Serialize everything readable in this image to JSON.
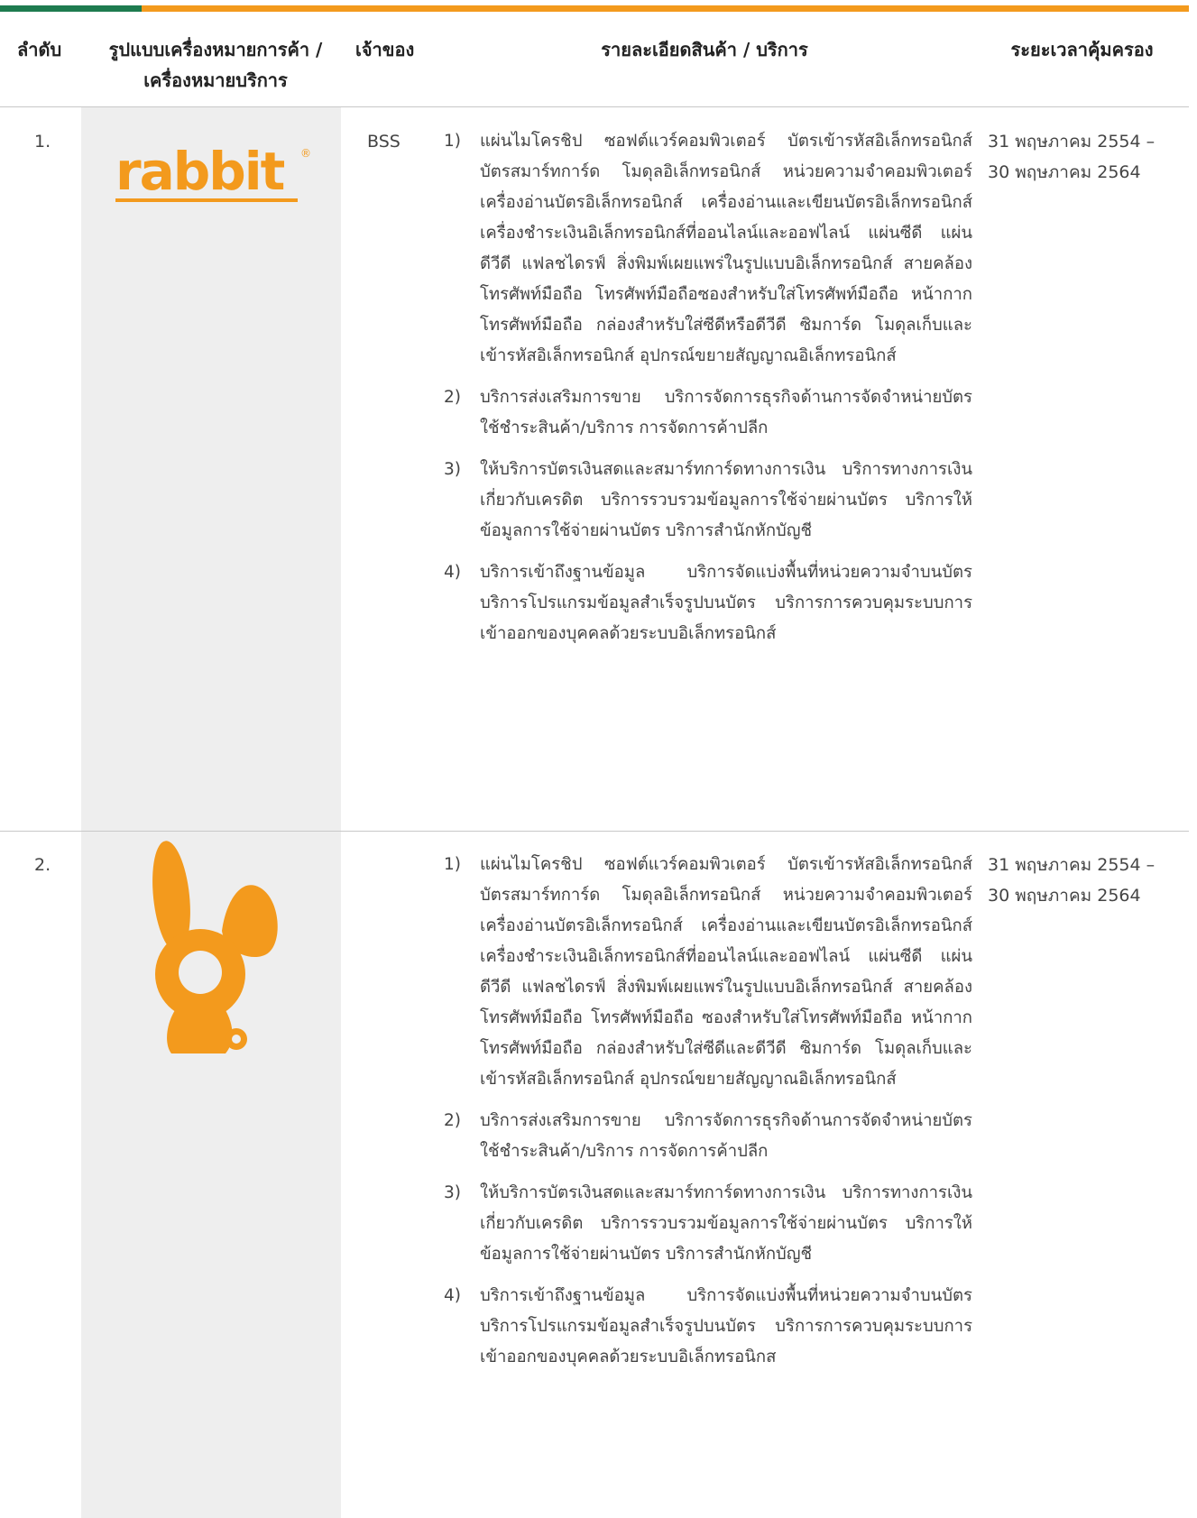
{
  "header": {
    "order": "ลำดับ",
    "logo_line1": "รูปแบบเครื่องหมายการค้า /",
    "logo_line2": "เครื่องหมายบริการ",
    "owner": "เจ้าของ",
    "detail": "รายละเอียดสินค้า / บริการ",
    "period": "ระยะเวลาคุ้มครอง"
  },
  "colors": {
    "brand_orange": "#f39a1d",
    "brand_green": "#1e7b4f",
    "shade": "#eeeeee"
  },
  "rows": [
    {
      "order": "1.",
      "logo_icon": "rabbit-wordmark-logo",
      "logo_text": "rabbit",
      "registered_mark": "®",
      "owner": "BSS",
      "period_line1": "31 พฤษภาคม 2554 –",
      "period_line2": "30 พฤษภาคม 2564",
      "items": [
        {
          "num": "1)",
          "text": "แผ่นไมโครชิป ซอฟต์แวร์คอมพิวเตอร์ บัตรเข้ารหัสอิเล็กทรอนิกส์ บัตรสมาร์ทการ์ด โมดุลอิเล็กทรอนิกส์ หน่วยความจำคอมพิวเตอร์ เครื่องอ่านบัตรอิเล็กทรอนิกส์ เครื่องอ่านและเขียนบัตรอิเล็กทรอนิกส์ เครื่องชำระเงินอิเล็กทรอนิกส์ที่ออนไลน์และออฟไลน์ แผ่นซีดี แผ่นดีวีดี แฟลชไดรฟ์ สิ่งพิมพ์เผยแพร่ในรูปแบบอิเล็กทรอนิกส์ สายคล้องโทรศัพท์มือถือ โทรศัพท์มือถือซองสำหรับใส่โทรศัพท์มือถือ หน้ากากโทรศัพท์มือถือ กล่องสำหรับใส่ซีดีหรือดีวีดี ซิมการ์ด โมดุลเก็บและเข้ารหัสอิเล็กทรอนิกส์ อุปกรณ์ขยายสัญญาณอิเล็กทรอนิกส์"
        },
        {
          "num": "2)",
          "text": "บริการส่งเสริมการขาย บริการจัดการธุรกิจด้านการจัดจำหน่ายบัตรใช้ชำระสินค้า/บริการ การจัดการค้าปลีก"
        },
        {
          "num": "3)",
          "text": "ให้บริการบัตรเงินสดและสมาร์ทการ์ดทางการเงิน บริการทางการเงินเกี่ยวกับเครดิต บริการรวบรวมข้อมูลการใช้จ่ายผ่านบัตร บริการให้ข้อมูลการใช้จ่ายผ่านบัตร บริการสำนักหักบัญชี"
        },
        {
          "num": "4)",
          "text": "บริการเข้าถึงฐานข้อมูล บริการจัดแบ่งพื้นที่หน่วยความจำบนบัตร บริการโปรแกรมข้อมูลสำเร็จรูปบนบัตร บริการการควบคุมระบบการเข้าออกของบุคคลด้วยระบบอิเล็กทรอนิกส์"
        }
      ]
    },
    {
      "order": "2.",
      "logo_icon": "bunny-mascot-logo",
      "owner": "",
      "period_line1": "31 พฤษภาคม 2554 –",
      "period_line2": "30 พฤษภาคม 2564",
      "items": [
        {
          "num": "1)",
          "text": "แผ่นไมโครชิป ซอฟต์แวร์คอมพิวเตอร์ บัตรเข้ารหัสอิเล็กทรอนิกส์ บัตรสมาร์ทการ์ด โมดุลอิเล็กทรอนิกส์ หน่วยความจำคอมพิวเตอร์ เครื่องอ่านบัตรอิเล็กทรอนิกส์ เครื่องอ่านและเขียนบัตรอิเล็กทรอนิกส์ เครื่องชำระเงินอิเล็กทรอนิกส์ที่ออนไลน์และออฟไลน์ แผ่นซีดี แผ่นดีวีดี แฟลชไดรฟ์ สิ่งพิมพ์เผยแพร่ในรูปแบบอิเล็กทรอนิกส์ สายคล้องโทรศัพท์มือถือ โทรศัพท์มือถือ ซองสำหรับใส่โทรศัพท์มือถือ หน้ากากโทรศัพท์มือถือ กล่องสำหรับใส่ซีดีและดีวีดี ซิมการ์ด โมดุลเก็บและเข้ารหัสอิเล็กทรอนิกส์ อุปกรณ์ขยายสัญญาณอิเล็กทรอนิกส์"
        },
        {
          "num": "2)",
          "text": "บริการส่งเสริมการขาย บริการจัดการธุรกิจด้านการจัดจำหน่ายบัตรใช้ชำระสินค้า/บริการ การจัดการค้าปลีก"
        },
        {
          "num": "3)",
          "text": "ให้บริการบัตรเงินสดและสมาร์ทการ์ดทางการเงิน บริการทางการเงินเกี่ยวกับเครดิต บริการรวบรวมข้อมูลการใช้จ่ายผ่านบัตร บริการให้ข้อมูลการใช้จ่ายผ่านบัตร บริการสำนักหักบัญชี"
        },
        {
          "num": "4)",
          "text": "บริการเข้าถึงฐานข้อมูล บริการจัดแบ่งพื้นที่หน่วยความจำบนบัตร บริการโปรแกรมข้อมูลสำเร็จรูปบนบัตร บริการการควบคุมระบบการเข้าออกของบุคคลด้วยระบบอิเล็กทรอนิกส"
        }
      ]
    }
  ]
}
